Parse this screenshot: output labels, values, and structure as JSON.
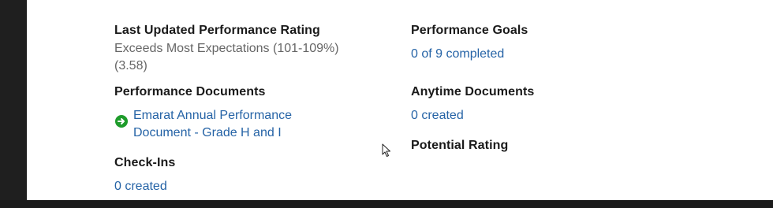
{
  "left": {
    "rating_heading": "Last Updated Performance Rating",
    "rating_value_line1": "Exceeds Most Expectations (101-109%)",
    "rating_value_line2": "(3.58)",
    "documents_heading": "Performance Documents",
    "document_link_line1": "Emarat Annual Performance",
    "document_link_line2": "Document - Grade H and I",
    "checkins_heading": "Check-Ins",
    "checkins_link": "0 created"
  },
  "right": {
    "goals_heading": "Performance Goals",
    "goals_link": "0 of 9 completed",
    "anytime_heading": "Anytime Documents",
    "anytime_link": "0 created",
    "potential_heading": "Potential Rating"
  },
  "colors": {
    "link": "#2563a6",
    "heading": "#1a1a1a",
    "muted": "#666666",
    "icon_green": "#1e9c2b"
  },
  "icons": [
    "arrow-right-circle-icon",
    "mouse-pointer-icon"
  ]
}
